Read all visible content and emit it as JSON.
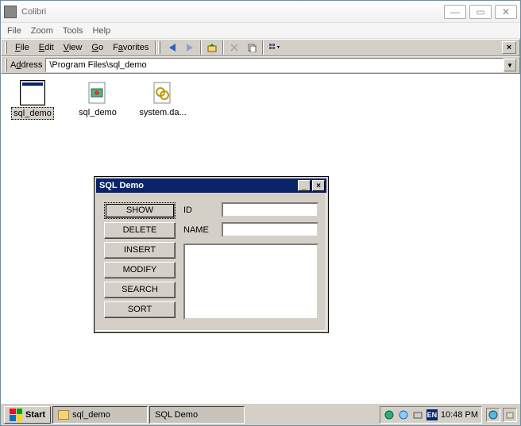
{
  "window": {
    "title": "Colibri"
  },
  "outer_menu": {
    "file": "File",
    "zoom": "Zoom",
    "tools": "Tools",
    "help": "Help"
  },
  "explorer_menu": {
    "file": "File",
    "edit": "Edit",
    "view": "View",
    "go": "Go",
    "favorites": "Favorites"
  },
  "address": {
    "label": "Address",
    "path": "\\Program Files\\sql_demo"
  },
  "files": [
    {
      "name": "sql_demo",
      "type": "app",
      "selected": true
    },
    {
      "name": "sql_demo",
      "type": "config",
      "selected": false
    },
    {
      "name": "system.da...",
      "type": "data",
      "selected": false
    }
  ],
  "sql": {
    "title": "SQL Demo",
    "buttons": {
      "show": "SHOW",
      "delete": "DELETE",
      "insert": "INSERT",
      "modify": "MODIFY",
      "search": "SEARCH",
      "sort": "SORT"
    },
    "fields": {
      "id": "ID",
      "name": "NAME"
    }
  },
  "taskbar": {
    "start": "Start",
    "tasks": [
      {
        "label": "sql_demo",
        "active": true,
        "icon": "folder"
      },
      {
        "label": "SQL Demo",
        "active": false,
        "icon": "app"
      }
    ],
    "tray": {
      "lang": "EN",
      "time": "10:48 PM"
    }
  }
}
